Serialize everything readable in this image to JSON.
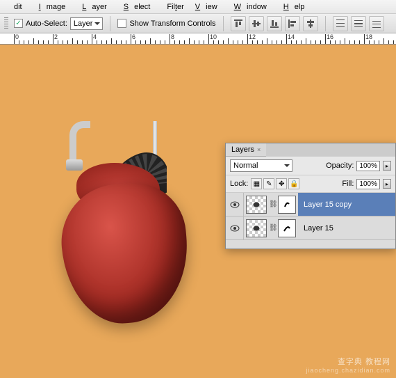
{
  "menu": {
    "edit": "dit",
    "image": "Image",
    "layer": "Layer",
    "select": "Select",
    "filter": "Filter",
    "view": "View",
    "window": "Window",
    "help": "Help"
  },
  "options": {
    "auto_select_label": "Auto-Select:",
    "auto_select_value": "Layer",
    "show_transform_label": "Show Transform Controls"
  },
  "ruler": {
    "marks": [
      "0",
      "2",
      "4",
      "6",
      "8",
      "10",
      "12",
      "14",
      "16",
      "18"
    ]
  },
  "layers_panel": {
    "title": "Layers",
    "blend_mode": "Normal",
    "opacity_label": "Opacity:",
    "opacity_value": "100%",
    "lock_label": "Lock:",
    "fill_label": "Fill:",
    "fill_value": "100%",
    "layers": [
      {
        "name": "Layer 15 copy",
        "selected": true
      },
      {
        "name": "Layer 15",
        "selected": false
      }
    ]
  },
  "watermark": {
    "main": "查字典 教程网",
    "sub": "jiaocheng.chazidian.com"
  }
}
